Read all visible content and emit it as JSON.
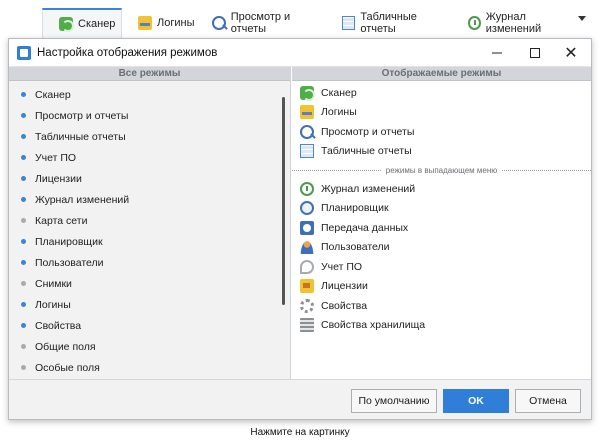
{
  "tabs": [
    {
      "label": "Сканер",
      "icon": "scanner-icon",
      "active": true
    },
    {
      "label": "Логины",
      "icon": "logs-icon",
      "active": false
    },
    {
      "label": "Просмотр и отчеты",
      "icon": "view-reports-icon",
      "active": false
    },
    {
      "label": "Табличные отчеты",
      "icon": "table-reports-icon",
      "active": false
    },
    {
      "label": "Журнал изменений",
      "icon": "change-log-icon",
      "active": false
    }
  ],
  "dialog": {
    "title": "Настройка отображения режимов",
    "close_glyph": "✕",
    "left_header": "Все режимы",
    "right_header": "Отображаемые режимы",
    "left_items": [
      {
        "label": "Сканер",
        "state": "blue"
      },
      {
        "label": "Просмотр и отчеты",
        "state": "blue"
      },
      {
        "label": "Табличные отчеты",
        "state": "blue"
      },
      {
        "label": "Учет ПО",
        "state": "blue"
      },
      {
        "label": "Лицензии",
        "state": "blue"
      },
      {
        "label": "Журнал изменений",
        "state": "blue"
      },
      {
        "label": "Карта сети",
        "state": "gray"
      },
      {
        "label": "Планировщик",
        "state": "blue"
      },
      {
        "label": "Пользователи",
        "state": "blue"
      },
      {
        "label": "Снимки",
        "state": "gray"
      },
      {
        "label": "Логины",
        "state": "blue"
      },
      {
        "label": "Свойства",
        "state": "blue"
      },
      {
        "label": "Общие поля",
        "state": "gray"
      },
      {
        "label": "Особые поля",
        "state": "gray"
      }
    ],
    "right_items_top": [
      {
        "label": "Сканер",
        "icon": "scanner-icon"
      },
      {
        "label": "Логины",
        "icon": "logs-icon"
      },
      {
        "label": "Просмотр и отчеты",
        "icon": "view-reports-icon"
      },
      {
        "label": "Табличные отчеты",
        "icon": "table-reports-icon"
      }
    ],
    "separator_label": "режимы в выпадающем меню",
    "right_items_dropdown": [
      {
        "label": "Журнал изменений",
        "icon": "change-log-icon"
      },
      {
        "label": "Планировщик",
        "icon": "planner-icon"
      },
      {
        "label": "Передача данных",
        "icon": "data-transfer-icon"
      },
      {
        "label": "Пользователи",
        "icon": "users-icon"
      },
      {
        "label": "Учет ПО",
        "icon": "software-icon"
      },
      {
        "label": "Лицензии",
        "icon": "licenses-icon"
      },
      {
        "label": "Свойства",
        "icon": "properties-icon"
      },
      {
        "label": "Свойства хранилища",
        "icon": "storage-properties-icon"
      }
    ],
    "buttons": {
      "default_label": "По умолчанию",
      "ok_label": "OK",
      "cancel_label": "Отмена"
    }
  },
  "caption": "Нажмите на картинку",
  "colors": {
    "accent": "#2f7fd8",
    "dot_active": "#3b84d6",
    "dot_inactive": "#a7abb0"
  }
}
